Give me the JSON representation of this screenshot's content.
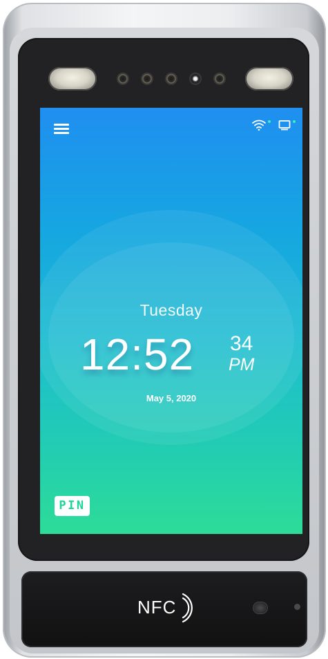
{
  "clock": {
    "day": "Tuesday",
    "hour_minute": "12:52",
    "seconds": "34",
    "ampm": "PM",
    "date": "May 5, 2020"
  },
  "pin_button": {
    "label": "PIN"
  },
  "nfc_panel": {
    "label": "NFC"
  },
  "icons": {
    "menu": "hamburger-menu-icon",
    "wifi": "wifi-icon",
    "monitor": "monitor-icon",
    "nfc": "nfc-waves-icon"
  },
  "colors": {
    "screen_top": "#1f8ff0",
    "screen_bottom": "#2ddc98",
    "pin_text": "#1ed59a",
    "status_dot": "#35f0c8"
  }
}
